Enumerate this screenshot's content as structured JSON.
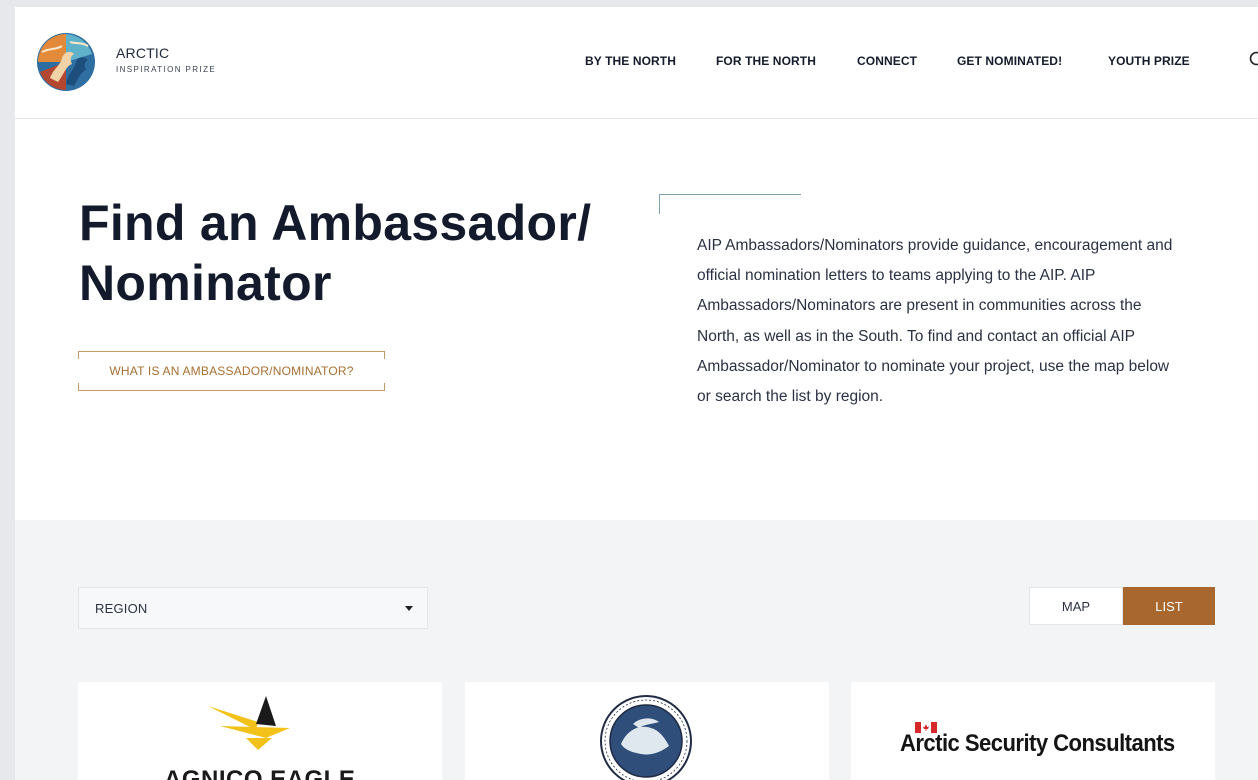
{
  "header": {
    "brand_title": "ARCTIC",
    "brand_subtitle": "INSPIRATION PRIZE",
    "nav": [
      {
        "label": "BY THE NORTH"
      },
      {
        "label": "FOR THE NORTH"
      },
      {
        "label": "CONNECT"
      },
      {
        "label": "GET NOMINATED!"
      },
      {
        "label": "YOUTH PRIZE"
      }
    ]
  },
  "hero": {
    "title_line1": "Find an Ambassador/",
    "title_line2": "Nominator",
    "what_button": "WHAT IS AN AMBASSADOR/NOMINATOR?",
    "description": "AIP Ambassadors/Nominators provide guidance, encouragement and official nomination letters to teams applying to the AIP. AIP Ambassadors/Nominators are present in communities across the North, as well as in the South. To find and contact an official AIP Ambassador/Nominator to nominate your project, use the map below or search the list by region."
  },
  "filters": {
    "region_label": "REGION",
    "view_map": "MAP",
    "view_list": "LIST",
    "active_view": "LIST"
  },
  "cards": [
    {
      "logo_text": "AGNICO EAGLE"
    },
    {
      "logo_text": ""
    },
    {
      "logo_text": "Arctic Security Consultants"
    }
  ],
  "colors": {
    "accent": "#a8672e",
    "accent_line": "#7fa3b2",
    "dark_text": "#121a2c"
  }
}
